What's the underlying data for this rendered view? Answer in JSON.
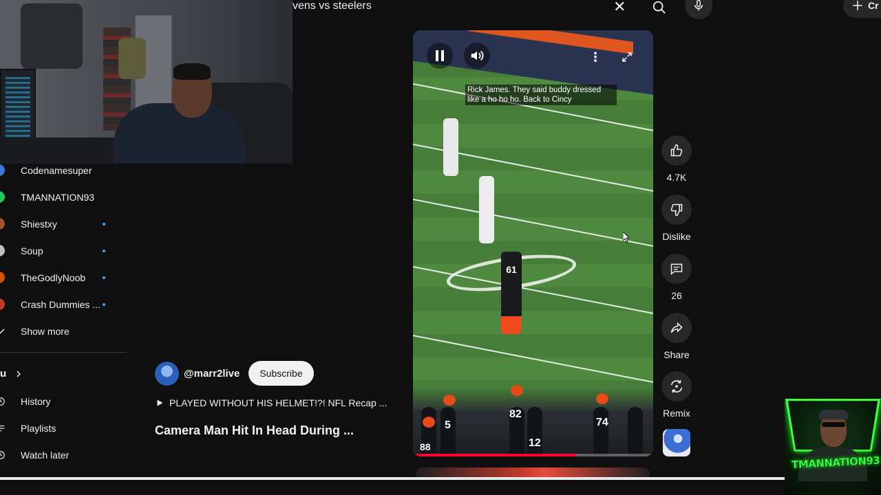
{
  "search": {
    "query_text": "vens vs steelers"
  },
  "header": {
    "create_label": "Cr"
  },
  "sidebar": {
    "subscriptions": [
      {
        "label": "Codenamesuper",
        "has_dot": false,
        "avatar_color": "#3a7bd5"
      },
      {
        "label": "TMANNATION93",
        "has_dot": false,
        "avatar_color": "#22c55e"
      },
      {
        "label": "Shiestxy",
        "has_dot": true,
        "avatar_color": "#a0522d"
      },
      {
        "label": "Soup",
        "has_dot": true,
        "avatar_color": "#c0c0c0"
      },
      {
        "label": "TheGodlyNoob",
        "has_dot": true,
        "avatar_color": "#d35400"
      },
      {
        "label": "Crash Dummies ...",
        "has_dot": true,
        "avatar_color": "#c0392b"
      }
    ],
    "show_more_label": "Show more",
    "you_heading": "u",
    "you_items": [
      {
        "label": "History",
        "icon": "history-icon"
      },
      {
        "label": "Playlists",
        "icon": "playlists-icon"
      },
      {
        "label": "Watch later",
        "icon": "watch-later-icon"
      }
    ]
  },
  "previous_short": {
    "channel_handle": "@marr2live",
    "subscribe_label": "Subscribe",
    "played_text": "PLAYED WITHOUT HIS HELMET!?! NFL Recap ...",
    "title": "Camera Man Hit In Head During ..."
  },
  "player": {
    "caption": "Rick James. They said buddy dressed like a ho ho ho. Back to Cincy",
    "progress_fraction": 0.68,
    "jersey_61": "61",
    "jersey_5": "5",
    "jersey_82": "82",
    "jersey_12": "12",
    "jersey_74": "74",
    "jersey_88": "88"
  },
  "actions": {
    "like_count": "4.7K",
    "dislike_label": "Dislike",
    "comment_count": "26",
    "share_label": "Share",
    "remix_label": "Remix"
  },
  "overlay": {
    "logo_text": "TMANNATION93"
  },
  "colors": {
    "background": "#0f0f0f",
    "accent_red": "#ff0033",
    "dot_blue": "#3ea6ff",
    "logo_green": "#2aff3a"
  }
}
